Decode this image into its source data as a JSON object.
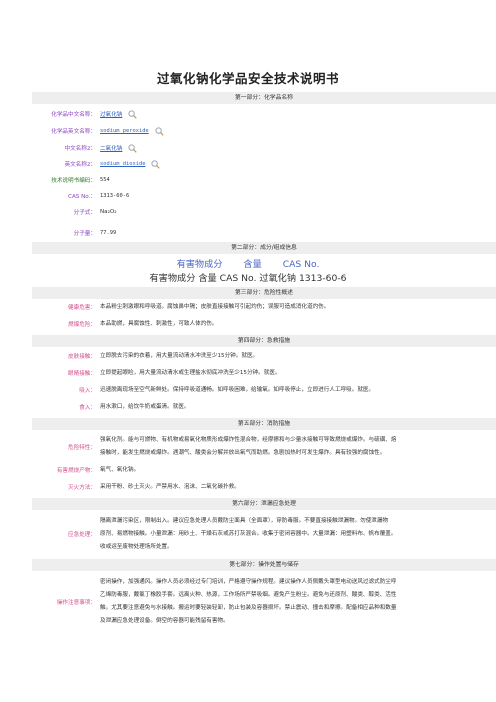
{
  "title": "过氧化钠化学品安全技术说明书",
  "sections": {
    "s1": "第一部分：化学品名称",
    "s2": "第二部分：成分/组成信息",
    "s3": "第三部分：危险性概述",
    "s4": "第四部分：急救措施",
    "s5": "第五部分：消防措施",
    "s6": "第六部分：泄漏应急处理",
    "s7": "第七部分：操作处置与储存"
  },
  "part1": {
    "cn_name_label": "化学品中文名称：",
    "cn_name_value": "过氧化钠",
    "en_name_label": "化学品英文名称：",
    "en_name_value": "sodium peroxide",
    "cn_alias_label": "中文名称2：",
    "cn_alias_value": "二氧化钠",
    "en_alias_label": "英文名称2：",
    "en_alias_value": "sodium dioxide",
    "code_label": "技术说明书编码：",
    "code_value": "554",
    "cas_label": "CAS No.：",
    "cas_value": "1313-60-6",
    "formula_label": "分子式：",
    "formula_value": "Na₂O₂",
    "weight_label": "分子量：",
    "weight_value": "77.99"
  },
  "part2": {
    "h1": "有害物成分",
    "h2": "含量",
    "h3": "CAS No.",
    "row": "有害物成分 含量 CAS No. 过氧化钠 1313-60-6"
  },
  "part3": {
    "health_label": "健康危害：",
    "health_text": "本品粉尘刺激眼和呼吸道。腐蚀鼻中隔；皮肤直接接触可引起灼伤；误服可造成消化道灼伤。",
    "env_label": "燃爆危险：",
    "env_text": "本品助燃，具腐蚀性、刺激性，可致人体灼伤。"
  },
  "part4": {
    "skin_label": "皮肤接触：",
    "skin_text": "立即脱去污染的衣着，用大量流动清水冲洗至少15分钟。就医。",
    "eye_label": "眼睛接触：",
    "eye_text": "立即提起眼睑，用大量流动清水或生理盐水彻底冲洗至少15分钟。就医。",
    "inhale_label": "吸入：",
    "inhale_text": "迅速脱离现场至空气新鲜处。保持呼吸道通畅。如呼吸困难，给输氧。如呼吸停止，立即进行人工呼吸。就医。",
    "ingest_label": "食入：",
    "ingest_text": "用水漱口，给饮牛奶或蛋清。就医。"
  },
  "part5": {
    "hazard_label": "危险特性：",
    "hazard_line1": "强氧化剂。能与可燃物、有机物或易氧化物质形成爆炸性混合物，经摩擦和与少量水接触可导致燃烧或爆炸。与硫磺、熔",
    "hazard_line2": "接触时，能发生燃烧或爆炸。遇潮气、酸类会分解并放出氧气而助燃。急剧加热时可发生爆炸。具有较强的腐蚀性。",
    "products_label": "有害燃烧产物：",
    "products_text": "氧气、氧化钠。",
    "extinguish_label": "灭火方法：",
    "extinguish_text": "采用干粉、砂土灭火。严禁用水、泡沫、二氧化碳扑救。"
  },
  "part6": {
    "label": "应急处理：",
    "line1": "隔离泄漏污染区，限制出入。建议应急处理人员戴防尘面具（全面罩），穿防毒服。不要直接接触泄漏物。勿使泄漏物",
    "line2": "原剂、易燃物接触。小量泄漏：用砂土、干燥石灰或苏打灰混合。收集于密闭容器中。大量泄漏：用塑料布、帆布覆盖。",
    "line3": "收或运至废物处理场所处置。"
  },
  "part7": {
    "label": "操作注意事项：",
    "line1": "密闭操作，加强通风。操作人员必须经过专门培训，严格遵守操作规程。建议操作人员佩戴头罩型电动送风过滤式防尘呼",
    "line2": "乙烯防毒服，戴氯丁橡胶手套。远离火种、热源，工作场所严禁吸烟。避免产生粉尘。避免与还原剂、酸类、醇类、活性",
    "line3": "触。尤其要注意避免与水接触。搬运时要轻装轻卸，防止包装及容器损坏。禁止震动、撞击和摩擦。配备相应品种和数量",
    "line4": "及泄漏应急处理设备。倒空的容器可能残留有害物。"
  }
}
